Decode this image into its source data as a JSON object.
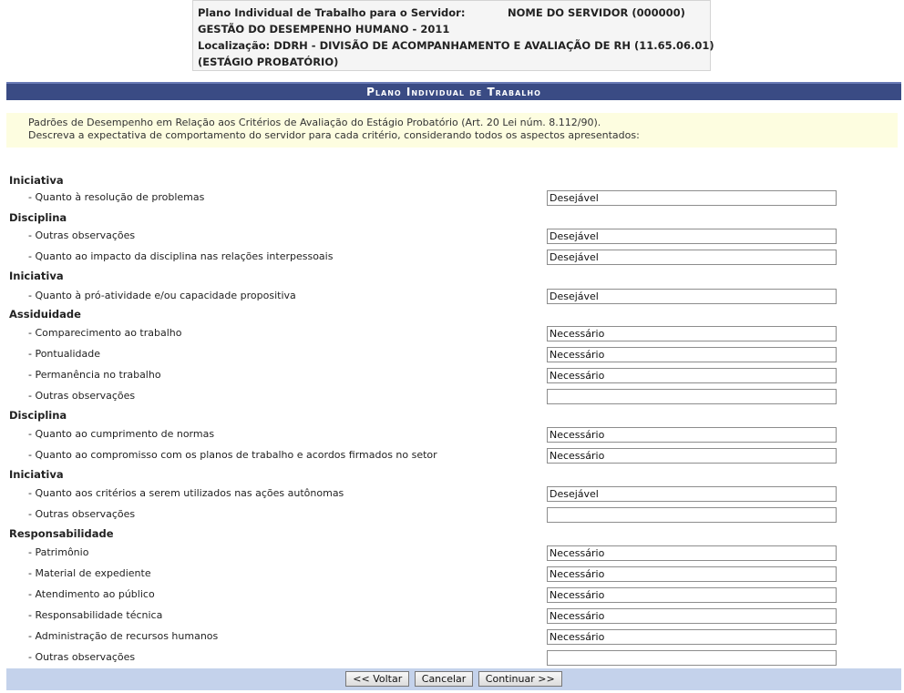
{
  "header": {
    "plan_label": "Plano Individual de Trabalho para o Servidor:",
    "server_name": "NOME DO SERVIDOR (000000)",
    "section": "GESTÃO DO DESEMPENHO HUMANO - 2011",
    "location": "Localização: DDRH - DIVISÃO DE ACOMPANHAMENTO E AVALIAÇÃO DE RH (11.65.06.01)",
    "stage": "(ESTÁGIO PROBATÓRIO)"
  },
  "panel": {
    "title": "Plano Individual de Trabalho",
    "instruction_line1": "Padrões de Desempenho em Relação aos Critérios de Avaliação do Estágio Probatório (Art. 20 Lei núm. 8.112/90).",
    "instruction_line2": "Descreva a expectativa de comportamento do servidor para cada critério, considerando todos os aspectos apresentados:"
  },
  "rows": [
    {
      "kind": "cat",
      "text": "Iniciativa"
    },
    {
      "kind": "item",
      "text": "- Quanto à resolução de problemas",
      "value": "Desejável"
    },
    {
      "kind": "cat",
      "text": "Disciplina"
    },
    {
      "kind": "item",
      "text": "- Outras observações",
      "value": "Desejável"
    },
    {
      "kind": "item",
      "text": "- Quanto ao impacto da disciplina nas relações interpessoais",
      "value": "Desejável"
    },
    {
      "kind": "cat",
      "text": "Iniciativa"
    },
    {
      "kind": "item",
      "text": "- Quanto à pró-atividade e/ou capacidade propositiva",
      "value": "Desejável"
    },
    {
      "kind": "cat",
      "text": "Assiduidade"
    },
    {
      "kind": "item",
      "text": "- Comparecimento ao trabalho",
      "value": "Necessário"
    },
    {
      "kind": "item",
      "text": "- Pontualidade",
      "value": "Necessário"
    },
    {
      "kind": "item",
      "text": "- Permanência no trabalho",
      "value": "Necessário"
    },
    {
      "kind": "item",
      "text": "- Outras observações",
      "value": ""
    },
    {
      "kind": "cat",
      "text": "Disciplina"
    },
    {
      "kind": "item",
      "text": "- Quanto ao cumprimento de normas",
      "value": "Necessário"
    },
    {
      "kind": "item",
      "text": "- Quanto ao compromisso com os planos de trabalho e acordos firmados no setor",
      "value": "Necessário"
    },
    {
      "kind": "cat",
      "text": "Iniciativa"
    },
    {
      "kind": "item",
      "text": "- Quanto aos critérios a serem utilizados nas ações autônomas",
      "value": "Desejável"
    },
    {
      "kind": "item",
      "text": "- Outras observações",
      "value": ""
    },
    {
      "kind": "cat",
      "text": "Responsabilidade"
    },
    {
      "kind": "item",
      "text": "- Patrimônio",
      "value": "Necessário"
    },
    {
      "kind": "item",
      "text": "- Material de expediente",
      "value": "Necessário"
    },
    {
      "kind": "item",
      "text": "- Atendimento ao público",
      "value": "Necessário"
    },
    {
      "kind": "item",
      "text": "- Responsabilidade técnica",
      "value": "Necessário"
    },
    {
      "kind": "item",
      "text": "- Administração de recursos humanos",
      "value": "Necessário"
    },
    {
      "kind": "item",
      "text": "- Outras observações",
      "value": ""
    }
  ],
  "buttons": {
    "back": "<< Voltar",
    "cancel": "Cancelar",
    "continue": "Continuar >>"
  }
}
